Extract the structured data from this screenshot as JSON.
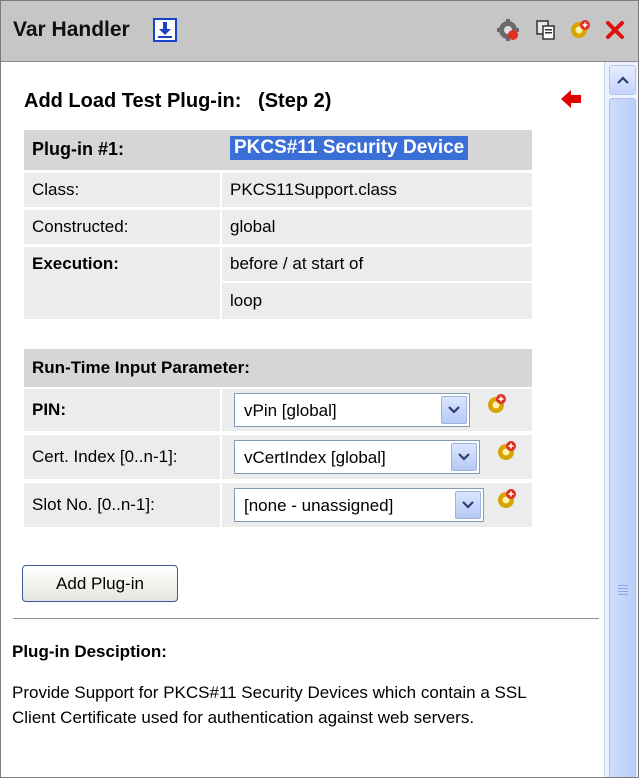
{
  "window": {
    "title": "Var Handler",
    "icons": [
      "download-icon",
      "settings-gear-icon",
      "copy-icon",
      "add-gear-icon",
      "close-icon"
    ]
  },
  "step": {
    "title": "Add Load Test Plug-in:   (Step 2)"
  },
  "plugin": {
    "header_label": "Plug-in #1:",
    "name": "PKCS#11 Security Device",
    "class_label": "Class:",
    "class_value": "PKCS11Support.class",
    "constructed_label": "Constructed:",
    "constructed_value": "global",
    "execution_label": "Execution:",
    "execution_value_line1": "before / at start of",
    "execution_value_line2": "loop"
  },
  "params": {
    "header": "Run-Time Input Parameter:",
    "rows": [
      {
        "label": "PIN:",
        "value": "vPin [global]"
      },
      {
        "label": "Cert. Index [0..n-1]:",
        "value": "vCertIndex [global]"
      },
      {
        "label": "Slot No. [0..n-1]:",
        "value": "[none - unassigned]"
      }
    ]
  },
  "actions": {
    "add_plugin": "Add Plug-in"
  },
  "description": {
    "title": "Plug-in Desciption:",
    "text": "Provide Support for PKCS#11 Security Devices which contain a SSL Client Certificate used for authentication against web servers."
  },
  "colors": {
    "titlebar": "#c6c6c6",
    "header_cell": "#d6d6d6",
    "light_cell": "#ececec",
    "selection": "#3b6fd8",
    "arrow": "#e00000",
    "close": "#e01010"
  }
}
